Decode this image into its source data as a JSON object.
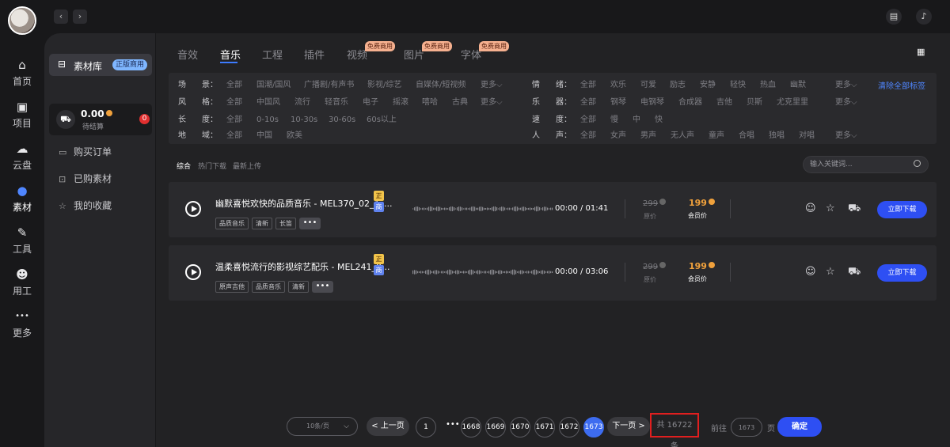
{
  "nav": {
    "back_icon": "chevron-left",
    "forward_icon": "chevron-right"
  },
  "rail": [
    {
      "label": "首页",
      "icon": "home-icon",
      "glyph": "⌂"
    },
    {
      "label": "项目",
      "icon": "folder-icon",
      "glyph": "▣"
    },
    {
      "label": "云盘",
      "icon": "cloud-icon",
      "glyph": "☁"
    },
    {
      "label": "素材",
      "icon": "material-icon",
      "glyph": "●"
    },
    {
      "label": "工具",
      "icon": "pen-icon",
      "glyph": "✎"
    },
    {
      "label": "用工",
      "icon": "people-icon",
      "glyph": "☻"
    },
    {
      "label": "更多",
      "icon": "more-icon",
      "glyph": "•••"
    }
  ],
  "panel": {
    "library_label": "素材库",
    "library_badge": "正版商用",
    "cart_amount": "0.00",
    "cart_sub": "待结算",
    "cart_count": "0",
    "menu": [
      "购买订单",
      "已购素材",
      "我的收藏"
    ]
  },
  "tabs": [
    "音效",
    "音乐",
    "工程",
    "插件",
    "视频",
    "图片",
    "字体"
  ],
  "free_tag": "免费商用",
  "filters": {
    "clear_label": "清除全部标签",
    "more_label": "更多",
    "left": [
      {
        "key": "场　　景：",
        "values": [
          "全部",
          "国潮/国风",
          "广播剧/有声书",
          "影视/综艺",
          "自媒体/短视频"
        ],
        "more": true
      },
      {
        "key": "风　　格：",
        "values": [
          "全部",
          "中国风",
          "流行",
          "轻音乐",
          "电子",
          "摇滚",
          "嘻哈",
          "古典"
        ],
        "more": true
      },
      {
        "key": "长　　度：",
        "values": [
          "全部",
          "0-10s",
          "10-30s",
          "30-60s",
          "60s以上"
        ],
        "more": false
      },
      {
        "key": "地　　域：",
        "values": [
          "全部",
          "中国",
          "欧美"
        ],
        "more": false
      }
    ],
    "right": [
      {
        "key": "情　　绪：",
        "values": [
          "全部",
          "欢乐",
          "可爱",
          "励志",
          "安静",
          "轻快",
          "热血",
          "幽默"
        ],
        "more": true
      },
      {
        "key": "乐　　器：",
        "values": [
          "全部",
          "钢琴",
          "电钢琴",
          "合成器",
          "吉他",
          "贝斯",
          "尤克里里"
        ],
        "more": true
      },
      {
        "key": "速　　度：",
        "values": [
          "全部",
          "慢",
          "中",
          "快"
        ],
        "more": false
      },
      {
        "key": "人　　声：",
        "values": [
          "全部",
          "女声",
          "男声",
          "无人声",
          "童声",
          "合唱",
          "独唱",
          "对唱"
        ],
        "more": true
      }
    ]
  },
  "sort": [
    "综合",
    "热门下载",
    "最新上传"
  ],
  "search": {
    "placeholder": "输入关键词..."
  },
  "tracks": [
    {
      "title": "幽默喜悦欢快的品质音乐 - MEL370_02_1_...",
      "badge_top": "正",
      "badge_bottom": "商",
      "tags": [
        "品质音乐",
        "清新",
        "长笛"
      ],
      "duration": "00:00 / 01:41",
      "orig_price": "299",
      "orig_label": "原价",
      "member_price": "199",
      "member_label": "会员价",
      "download_label": "立即下载"
    },
    {
      "title": "温柔喜悦流行的影视综艺配乐 - MEL241_0...",
      "badge_top": "正",
      "badge_bottom": "商",
      "tags": [
        "原声吉他",
        "品质音乐",
        "清新"
      ],
      "duration": "00:00 / 03:06",
      "orig_price": "299",
      "orig_label": "原价",
      "member_price": "199",
      "member_label": "会员价",
      "download_label": "立即下载"
    }
  ],
  "pagination": {
    "per_page": "10条/页",
    "prev": "< 上一页",
    "first": "1",
    "dots": "•••",
    "pages": [
      "1668",
      "1669",
      "1670",
      "1671",
      "1672",
      "1673"
    ],
    "current": "1673",
    "next": "下一页 >",
    "total": "共 16722 条",
    "goto_label": "前往",
    "goto_value": "1673",
    "page_unit": "页",
    "confirm": "确定"
  },
  "colors": {
    "accent": "#2e4ff3",
    "price": "#f0a13c",
    "highlight": "#e01f1f"
  }
}
